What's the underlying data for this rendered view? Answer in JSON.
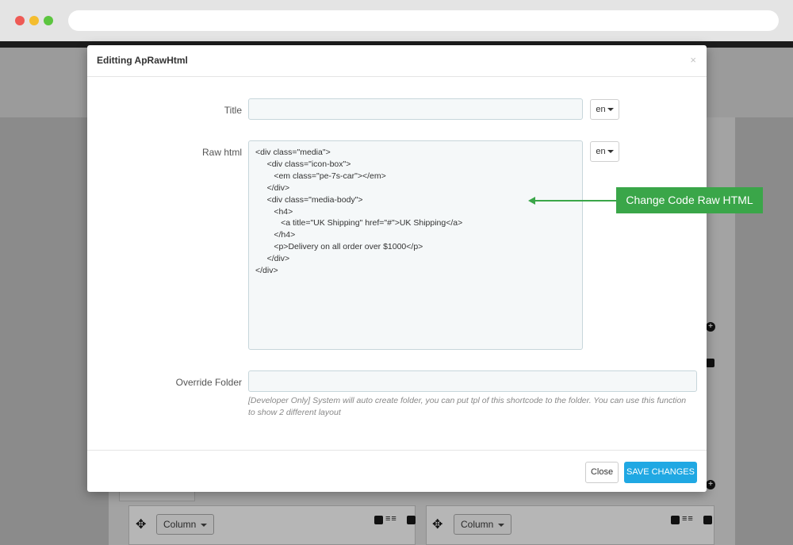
{
  "modal": {
    "title": "Editting ApRawHtml",
    "close_symbol": "×"
  },
  "form": {
    "title_label": "Title",
    "title_value": "",
    "title_lang": "en",
    "raw_html_label": "Raw html",
    "raw_html_lang": "en",
    "raw_html_lines": [
      "<div class=\"media\">",
      "     <div class=\"icon-box\">",
      "        <em class=\"pe-7s-car\"></em>",
      "     </div>",
      "     <div class=\"media-body\">",
      "        <h4>",
      "           <a title=\"UK Shipping\" href=\"#\">UK Shipping</a>",
      "        </h4>",
      "        <p>Delivery on all order over $1000</p>",
      "     </div>",
      "</div>"
    ],
    "override_folder_label": "Override Folder",
    "override_folder_value": "",
    "override_folder_help": "[Developer Only] System will auto create folder, you can put tpl of this shortcode to the folder. You can use this function to show 2 different layout"
  },
  "footer": {
    "close_label": "Close",
    "save_label": "SAVE CHANGES"
  },
  "annotation": {
    "text": "Change Code Raw HTML"
  },
  "background": {
    "column_label_1": "Column",
    "column_label_2": "Column"
  },
  "colors": {
    "accent_save": "#20a8e3",
    "annotation_green": "#3aa649"
  }
}
